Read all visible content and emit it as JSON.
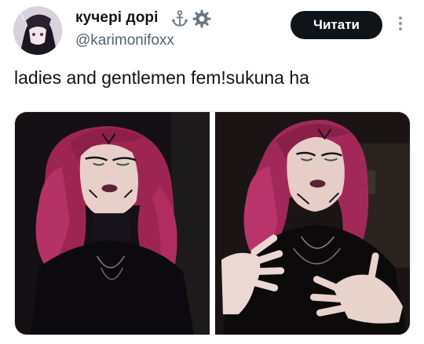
{
  "author": {
    "display_name": "кучері дорі",
    "handle": "@karimonifoxx",
    "avatar_icon": "avatar-image",
    "name_icons": [
      "anchor-icon",
      "gear-icon"
    ]
  },
  "actions": {
    "follow_label": "Читати",
    "more_icon": "more-vertical-icon"
  },
  "tweet": {
    "text": "ladies and gentlemen fem!sukuna ha"
  },
  "media": {
    "count": 2,
    "photos": [
      {
        "icon": "photo-portrait-pink-hair"
      },
      {
        "icon": "photo-portrait-hands"
      }
    ]
  },
  "colors": {
    "text": "#0f1419",
    "secondary": "#536471",
    "button_bg": "#0f1419",
    "button_text": "#ffffff",
    "hair": "#b3285f"
  }
}
